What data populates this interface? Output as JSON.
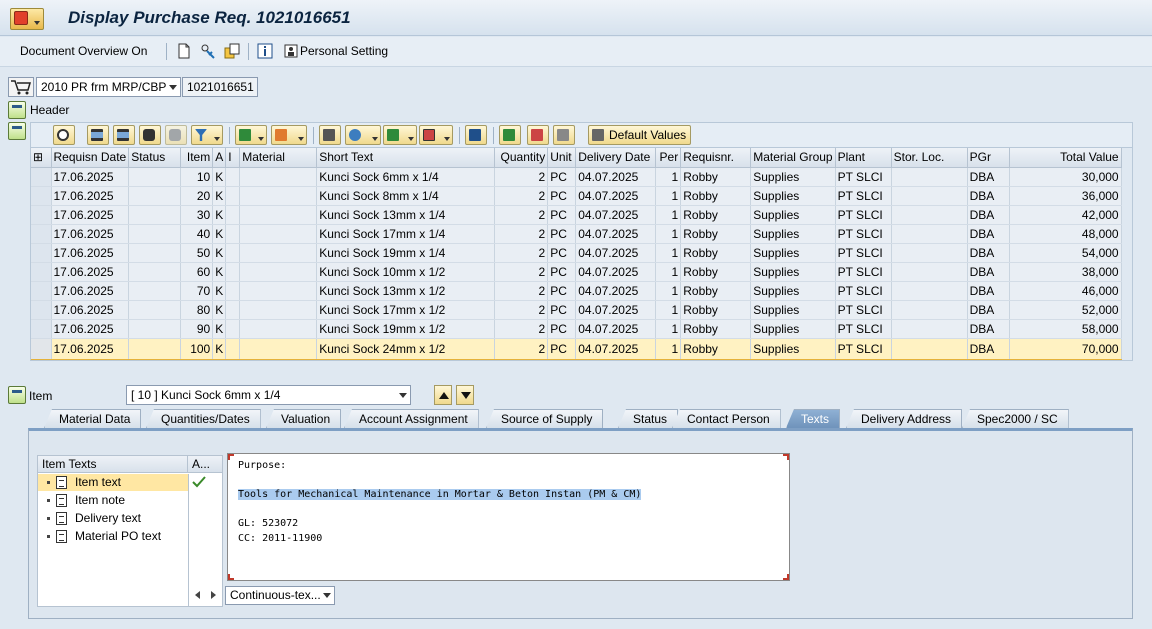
{
  "window": {
    "title": "Display Purchase Req. 1021016651"
  },
  "app_toolbar": {
    "document_overview_label": "Document Overview On",
    "personal_setting_label": "Personal Setting"
  },
  "document": {
    "doc_type_value": "2010 PR frm MRP/CBP",
    "doc_number_value": "1021016651"
  },
  "header": {
    "label": "Header"
  },
  "grid_toolbar": {
    "default_values_label": "Default Values"
  },
  "table": {
    "columns": [
      "Requisn Date",
      "Status",
      "Item",
      "A",
      "I",
      "Material",
      "Short Text",
      "Quantity",
      "Unit",
      "Delivery Date",
      "Per",
      "Requisnr.",
      "Material Group",
      "Plant",
      "Stor. Loc.",
      "PGr",
      "Total Value"
    ],
    "rows": [
      {
        "date": "17.06.2025",
        "status": "",
        "item": "10",
        "a": "K",
        "i": "",
        "material": "",
        "short_text": "Kunci Sock 6mm x 1/4",
        "quantity": "2",
        "unit": "PC",
        "delivery_date": "04.07.2025",
        "per": "1",
        "requisnr": "Robby",
        "material_group": "Supplies",
        "plant": "PT SLCI",
        "stor_loc": "",
        "pgr": "DBA",
        "total_value": "30,000"
      },
      {
        "date": "17.06.2025",
        "status": "",
        "item": "20",
        "a": "K",
        "i": "",
        "material": "",
        "short_text": "Kunci Sock 8mm x 1/4",
        "quantity": "2",
        "unit": "PC",
        "delivery_date": "04.07.2025",
        "per": "1",
        "requisnr": "Robby",
        "material_group": "Supplies",
        "plant": "PT SLCI",
        "stor_loc": "",
        "pgr": "DBA",
        "total_value": "36,000"
      },
      {
        "date": "17.06.2025",
        "status": "",
        "item": "30",
        "a": "K",
        "i": "",
        "material": "",
        "short_text": "Kunci Sock 13mm x 1/4",
        "quantity": "2",
        "unit": "PC",
        "delivery_date": "04.07.2025",
        "per": "1",
        "requisnr": "Robby",
        "material_group": "Supplies",
        "plant": "PT SLCI",
        "stor_loc": "",
        "pgr": "DBA",
        "total_value": "42,000"
      },
      {
        "date": "17.06.2025",
        "status": "",
        "item": "40",
        "a": "K",
        "i": "",
        "material": "",
        "short_text": "Kunci Sock 17mm x 1/4",
        "quantity": "2",
        "unit": "PC",
        "delivery_date": "04.07.2025",
        "per": "1",
        "requisnr": "Robby",
        "material_group": "Supplies",
        "plant": "PT SLCI",
        "stor_loc": "",
        "pgr": "DBA",
        "total_value": "48,000"
      },
      {
        "date": "17.06.2025",
        "status": "",
        "item": "50",
        "a": "K",
        "i": "",
        "material": "",
        "short_text": "Kunci Sock 19mm x 1/4",
        "quantity": "2",
        "unit": "PC",
        "delivery_date": "04.07.2025",
        "per": "1",
        "requisnr": "Robby",
        "material_group": "Supplies",
        "plant": "PT SLCI",
        "stor_loc": "",
        "pgr": "DBA",
        "total_value": "54,000"
      },
      {
        "date": "17.06.2025",
        "status": "",
        "item": "60",
        "a": "K",
        "i": "",
        "material": "",
        "short_text": "Kunci Sock 10mm x 1/2",
        "quantity": "2",
        "unit": "PC",
        "delivery_date": "04.07.2025",
        "per": "1",
        "requisnr": "Robby",
        "material_group": "Supplies",
        "plant": "PT SLCI",
        "stor_loc": "",
        "pgr": "DBA",
        "total_value": "38,000"
      },
      {
        "date": "17.06.2025",
        "status": "",
        "item": "70",
        "a": "K",
        "i": "",
        "material": "",
        "short_text": "Kunci Sock 13mm x 1/2",
        "quantity": "2",
        "unit": "PC",
        "delivery_date": "04.07.2025",
        "per": "1",
        "requisnr": "Robby",
        "material_group": "Supplies",
        "plant": "PT SLCI",
        "stor_loc": "",
        "pgr": "DBA",
        "total_value": "46,000"
      },
      {
        "date": "17.06.2025",
        "status": "",
        "item": "80",
        "a": "K",
        "i": "",
        "material": "",
        "short_text": "Kunci Sock 17mm x 1/2",
        "quantity": "2",
        "unit": "PC",
        "delivery_date": "04.07.2025",
        "per": "1",
        "requisnr": "Robby",
        "material_group": "Supplies",
        "plant": "PT SLCI",
        "stor_loc": "",
        "pgr": "DBA",
        "total_value": "52,000"
      },
      {
        "date": "17.06.2025",
        "status": "",
        "item": "90",
        "a": "K",
        "i": "",
        "material": "",
        "short_text": "Kunci Sock 19mm x 1/2",
        "quantity": "2",
        "unit": "PC",
        "delivery_date": "04.07.2025",
        "per": "1",
        "requisnr": "Robby",
        "material_group": "Supplies",
        "plant": "PT SLCI",
        "stor_loc": "",
        "pgr": "DBA",
        "total_value": "58,000"
      },
      {
        "date": "17.06.2025",
        "status": "",
        "item": "100",
        "a": "K",
        "i": "",
        "material": "",
        "short_text": "Kunci Sock 24mm x 1/2",
        "quantity": "2",
        "unit": "PC",
        "delivery_date": "04.07.2025",
        "per": "1",
        "requisnr": "Robby",
        "material_group": "Supplies",
        "plant": "PT SLCI",
        "stor_loc": "",
        "pgr": "DBA",
        "total_value": "70,000"
      }
    ]
  },
  "item_section": {
    "label": "Item",
    "selected_item": "[ 10 ] Kunci Sock 6mm x 1/4"
  },
  "tabs": [
    "Material Data",
    "Quantities/Dates",
    "Valuation",
    "Account Assignment",
    "Source of Supply",
    "Status",
    "Contact Person",
    "Texts",
    "Delivery Address",
    "Spec2000 / SC"
  ],
  "texts_panel": {
    "tree_header": "Item Texts",
    "tree_header_col2": "A...",
    "items": [
      "Item text",
      "Item note",
      "Delivery text",
      "Material PO text"
    ],
    "editor_lines": [
      "Purpose:",
      "",
      "Tools for Mechanical Maintenance in Mortar & Beton Instan (PM & CM)",
      "",
      "GL: 523072",
      "CC: 2011-11900"
    ],
    "format_value": "Continuous-tex..."
  },
  "colors": {
    "selected_row": "#fff2c2",
    "active_tab": "#7196be",
    "highlight_text": "#aacbef"
  }
}
